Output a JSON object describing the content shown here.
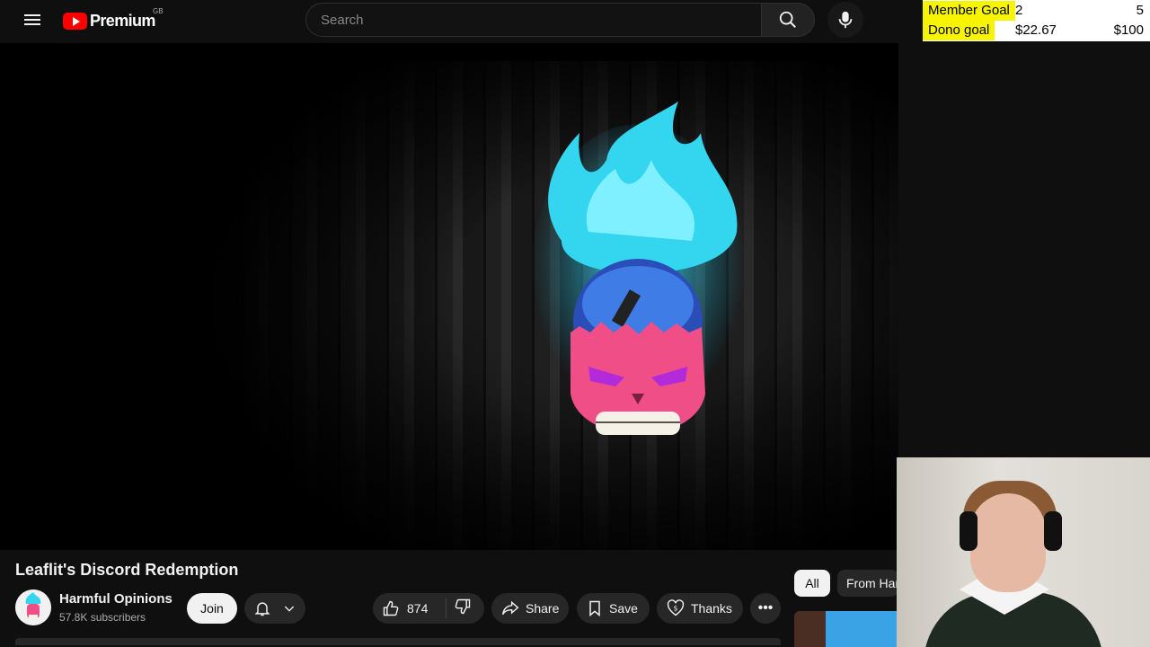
{
  "header": {
    "logo_text": "Premium",
    "country": "GB",
    "search_placeholder": "Search",
    "icons": [
      "menu-icon",
      "youtube-logo-icon",
      "search-icon",
      "microphone-icon"
    ]
  },
  "goals": {
    "member_label": "Member Goal",
    "member_current": "2",
    "member_target": "5",
    "dono_label": "Dono goal",
    "dono_current": "$22.67",
    "dono_target": "$100",
    "highlight_color": "#f6f400"
  },
  "video": {
    "title": "Leaflit's Discord Redemption"
  },
  "channel": {
    "name": "Harmful Opinions",
    "subscribers": "57.8K subscribers",
    "join_label": "Join"
  },
  "actions": {
    "like_count": "874",
    "share_label": "Share",
    "save_label": "Save",
    "thanks_label": "Thanks",
    "more_label": "•••"
  },
  "chips": {
    "all": "All",
    "from": "From Har"
  },
  "colors": {
    "background": "#0f0f0f",
    "brand_red": "#ff0000",
    "pill": "#272727"
  }
}
